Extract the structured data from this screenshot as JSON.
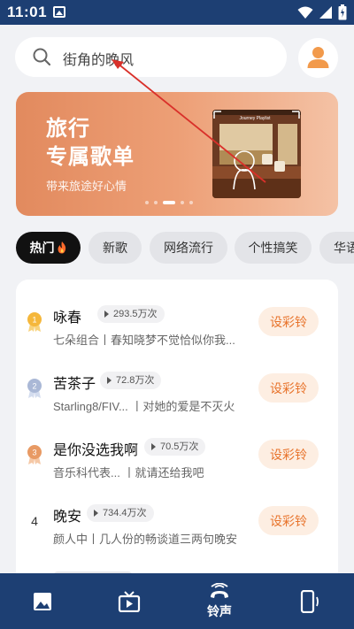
{
  "status": {
    "time": "11:01"
  },
  "search": {
    "text": "街角的晚风"
  },
  "banner": {
    "title_line1": "旅行",
    "title_line2": "专属歌单",
    "subtitle": "带来旅途好心情",
    "art_caption": "Journey Playlist"
  },
  "tabs": [
    {
      "label": "热门",
      "active": true
    },
    {
      "label": "新歌",
      "active": false
    },
    {
      "label": "网络流行",
      "active": false
    },
    {
      "label": "个性搞笑",
      "active": false
    },
    {
      "label": "华语",
      "active": false
    }
  ],
  "songs": [
    {
      "rank": "1",
      "title": "咏春",
      "plays": "293.5万次",
      "subtitle": "七朵组合丨春知晓梦不觉恰似你我...",
      "action": "设彩铃"
    },
    {
      "rank": "2",
      "title": "苦茶子",
      "plays": "72.8万次",
      "subtitle": "Starling8/FIV...   丨对她的爱是不灭火",
      "action": "设彩铃"
    },
    {
      "rank": "3",
      "title": "是你没选我啊",
      "plays": "70.5万次",
      "subtitle": "音乐科代表...   丨就请还给我吧",
      "action": "设彩铃"
    },
    {
      "rank": "4",
      "title": "晚安",
      "plays": "734.4万次",
      "subtitle": "颜人中丨几人份的畅谈道三两句晚安",
      "action": "设彩铃"
    }
  ],
  "bottom_nav": [
    {
      "icon": "image-icon",
      "label": ""
    },
    {
      "icon": "tv-icon",
      "label": ""
    },
    {
      "icon": "ringtone-icon",
      "label": "铃声",
      "active": true
    },
    {
      "icon": "phone-vibrate-icon",
      "label": ""
    }
  ],
  "colors": {
    "nav_bg": "#1d3f73",
    "accent": "#e8732b",
    "gold": "#f5b73b",
    "silver": "#aab8d6",
    "bronze": "#e89a64"
  }
}
